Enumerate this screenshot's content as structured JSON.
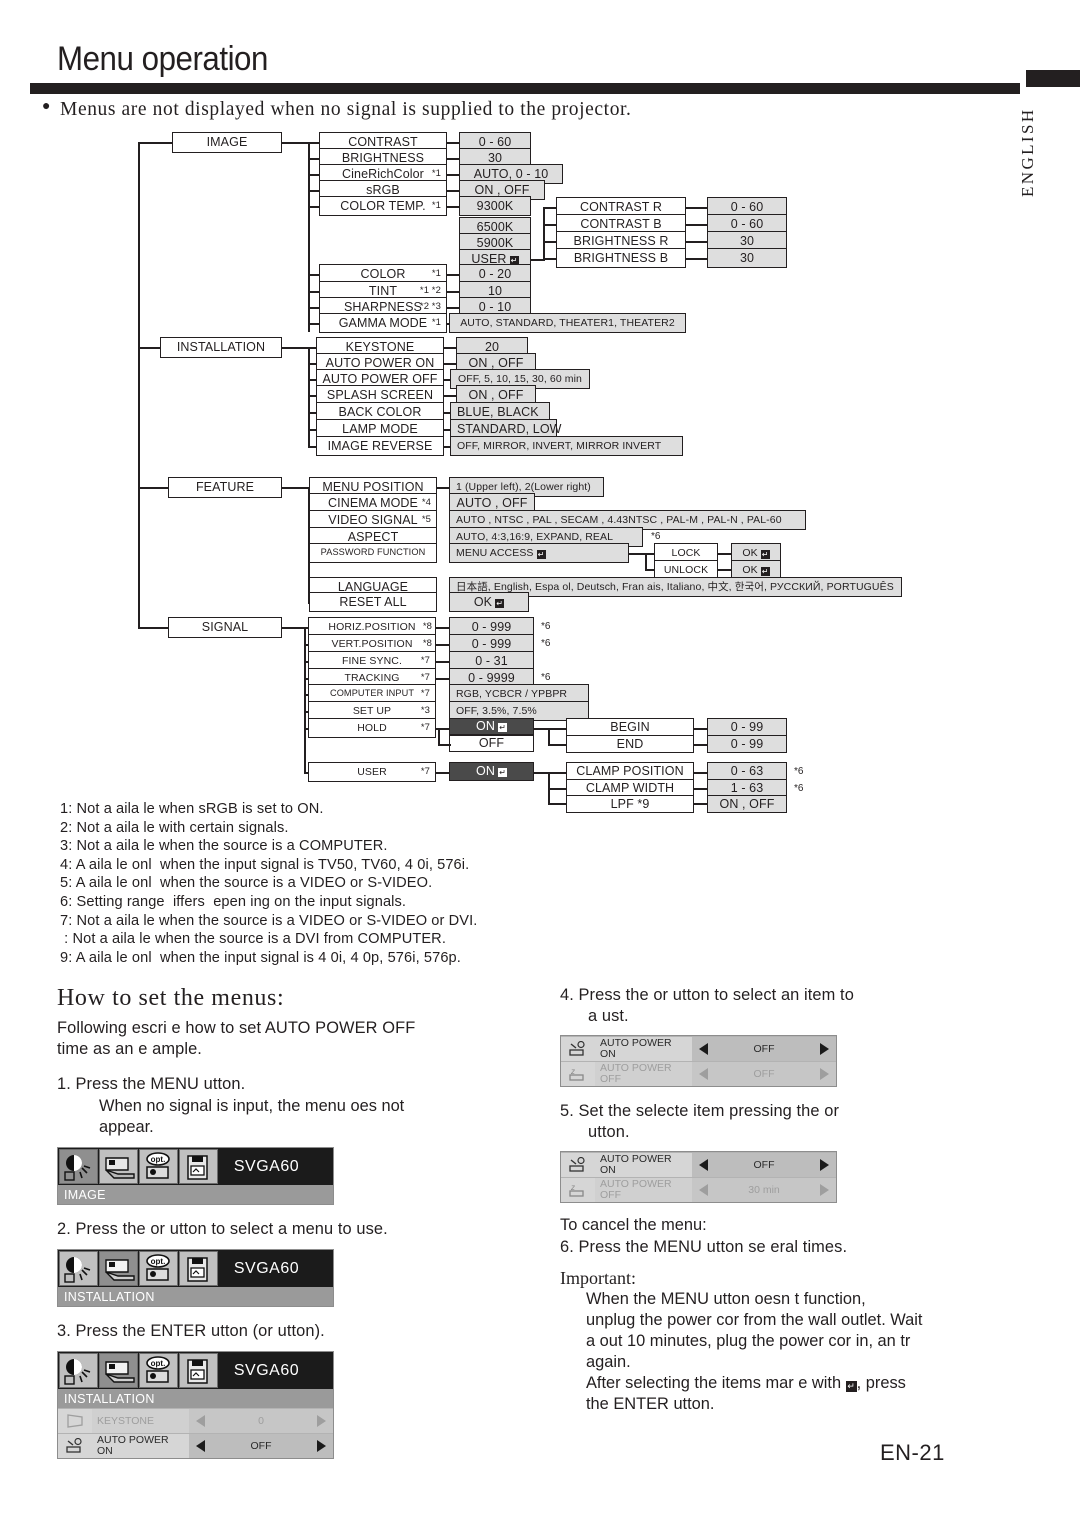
{
  "header": {
    "title": "Menu operation",
    "intro": "Menus are not displayed when no signal is supplied to the projector.",
    "language_tab": "ENGLISH",
    "page_number": "EN-21"
  },
  "tree": {
    "menus": [
      {
        "name": "IMAGE",
        "items": [
          {
            "label": "CONTRAST",
            "sup": "",
            "value": "0 - 60"
          },
          {
            "label": "BRIGHTNESS",
            "sup": "",
            "value": "30"
          },
          {
            "label": "CineRichColor",
            "sup": "*1",
            "value": "AUTO, 0 - 10"
          },
          {
            "label": "sRGB",
            "sup": "",
            "value": "ON , OFF"
          },
          {
            "label": "COLOR TEMP.",
            "sup": "*1",
            "value": "9300K"
          },
          {
            "label": "COLOR",
            "sup": "*1",
            "value": "0 - 20"
          },
          {
            "label": "TINT",
            "sup": "*1 *2",
            "value": "10"
          },
          {
            "label": "SHARPNESS",
            "sup": "*2 *3",
            "value": "0 - 10"
          },
          {
            "label": "GAMMA MODE",
            "sup": "*1",
            "value": "AUTO, STANDARD, THEATER1, THEATER2"
          }
        ]
      },
      {
        "name": "INSTALLATION",
        "items": [
          {
            "label": "KEYSTONE",
            "sup": "",
            "value": "20"
          },
          {
            "label": "AUTO POWER ON",
            "sup": "",
            "value": "ON , OFF"
          },
          {
            "label": "AUTO POWER OFF",
            "sup": "",
            "value": "OFF, 5, 10, 15, 30, 60 min"
          },
          {
            "label": "SPLASH SCREEN",
            "sup": "",
            "value": "ON , OFF"
          },
          {
            "label": "BACK COLOR",
            "sup": "",
            "value": "BLUE, BLACK"
          },
          {
            "label": "LAMP MODE",
            "sup": "",
            "value": "STANDARD, LOW"
          },
          {
            "label": "IMAGE REVERSE",
            "sup": "",
            "value": "OFF, MIRROR, INVERT, MIRROR INVERT"
          }
        ]
      },
      {
        "name": "FEATURE",
        "items": [
          {
            "label": "MENU POSITION",
            "sup": "",
            "value": "1 (Upper left), 2(Lower right)"
          },
          {
            "label": "CINEMA MODE",
            "sup": "*4",
            "value": "AUTO , OFF"
          },
          {
            "label": "VIDEO SIGNAL",
            "sup": "*5",
            "value": "AUTO , NTSC , PAL , SECAM , 4.43NTSC , PAL-M , PAL-N , PAL-60"
          },
          {
            "label": "ASPECT",
            "sup": "",
            "value": "AUTO, 4:3,16:9, EXPAND, REAL",
            "note": "*6"
          },
          {
            "label": "PASSWORD FUNCTION",
            "sup": "",
            "value": "MENU ACCESS"
          },
          {
            "label": "LANGUAGE",
            "sup": "",
            "value": "日本語, English, Espa ol, Deutsch, Fran ais, Italiano, 中文, 한국어, РУССКИЙ, PORTUGUÊS"
          },
          {
            "label": "RESET ALL",
            "sup": "",
            "value": "OK"
          }
        ]
      },
      {
        "name": "SIGNAL",
        "items": [
          {
            "label": "HORIZ.POSITION",
            "sup": "*8",
            "value": "0 - 999",
            "note": "*6"
          },
          {
            "label": "VERT.POSITION",
            "sup": "*8",
            "value": "0 - 999",
            "note": "*6"
          },
          {
            "label": "FINE SYNC.",
            "sup": "*7",
            "value": "0 - 31"
          },
          {
            "label": "TRACKING",
            "sup": "*7",
            "value": "0 - 9999",
            "note": "*6"
          },
          {
            "label": "COMPUTER INPUT",
            "sup": "*7",
            "value": "RGB, YCBCR / YPBPR"
          },
          {
            "label": "SET UP",
            "sup": "*3",
            "value": "OFF, 3.5%, 7.5%"
          },
          {
            "label": "HOLD",
            "sup": "*7",
            "value": "ON"
          },
          {
            "label": "USER",
            "sup": "*7",
            "value": "ON"
          }
        ]
      }
    ],
    "color_temp_options": [
      "9300K",
      "6500K",
      "5900K",
      "USER"
    ],
    "user_color_items": [
      {
        "label": "CONTRAST R",
        "value": "0 - 60"
      },
      {
        "label": "CONTRAST B",
        "value": "0 - 60"
      },
      {
        "label": "BRIGHTNESS R",
        "value": "30"
      },
      {
        "label": "BRIGHTNESS B",
        "value": "30"
      }
    ],
    "password_branch": [
      {
        "label": "LOCK",
        "value": "OK"
      },
      {
        "label": "UNLOCK",
        "value": "OK"
      }
    ],
    "hold_branch": {
      "on": "ON",
      "off": "OFF",
      "items": [
        {
          "label": "BEGIN",
          "value": "0 - 99"
        },
        {
          "label": "END",
          "value": "0 - 99"
        }
      ]
    },
    "user_branch": {
      "on": "ON",
      "items": [
        {
          "label": "CLAMP POSITION",
          "value": "0 - 63",
          "note": "*6"
        },
        {
          "label": "CLAMP WIDTH",
          "value": "1 - 63",
          "note": "*6"
        },
        {
          "label": "LPF *9",
          "value": "ON , OFF"
        }
      ]
    }
  },
  "footnotes": [
    "1: Not a aila le when sRGB is set to ON.",
    "2: Not a aila le with certain signals.",
    "3: Not a aila le when the source is a COMPUTER.",
    "4: A aila le onl  when the input signal is TV50, TV60, 4 0i, 576i.",
    "5: A aila le onl  when the source is a VIDEO or S-VIDEO.",
    "6: Setting range  iffers  epen ing on the input signals.",
    "7: Not a aila le when the source is a VIDEO or S-VIDEO or DVI.",
    " : Not a aila le when the source is a DVI from COMPUTER.",
    "9: A aila le onl  when the input signal is 4 0i, 4 0p, 576i, 576p."
  ],
  "how_to": {
    "heading": "How to set the menus:",
    "intro": "Following  escri e how to set AUTO POWER OFF\ntime as an e ample.",
    "step1": "1. Press the MENU  utton.",
    "step1_sub": "When no signal is input, the menu  oes not\nappear.",
    "step2": "2. Press the    or     utton to select a menu to use.",
    "step3": "3. Press the ENTER  utton (or     utton).",
    "step4": "4. Press the    or     utton to select an item to\n a ust.",
    "step5": "5. Set the selecte  item  pressing the    or\n  utton.",
    "cancel_title": "To cancel the menu:",
    "step6": "6. Press the MENU  utton se eral times.",
    "important_title": "Important:",
    "important_body": "When the MENU  utton  oesn t function,\nunplug the power cor  from the wall outlet. Wait\na out 10 minutes, plug the power cor  in, an  tr\nagain."
  },
  "osd": {
    "signal_label": "SVGA60",
    "icons": [
      "image-icon",
      "installation-icon",
      "feature-opt-icon",
      "signal-icon"
    ],
    "shot1": {
      "tab": "IMAGE",
      "selected_icon": 0,
      "rows": []
    },
    "shot2": {
      "tab": "INSTALLATION",
      "selected_icon": 1,
      "rows": []
    },
    "shot3": {
      "tab": "INSTALLATION",
      "selected_icon": 1,
      "rows": [
        {
          "icon": "keystone-icon",
          "label": "KEYSTONE",
          "value": "0",
          "dim": true
        },
        {
          "icon": "auto-power-on-icon",
          "label": "AUTO POWER\nON",
          "value": "OFF",
          "dim": false
        }
      ]
    },
    "shot4": {
      "rows": [
        {
          "icon": "auto-power-on-icon",
          "label": "AUTO POWER\nON",
          "value": "OFF",
          "dim": false
        },
        {
          "icon": "auto-power-off-icon",
          "label": "AUTO POWER\nOFF",
          "value": "OFF",
          "dim": true
        }
      ]
    },
    "shot5": {
      "rows": [
        {
          "icon": "auto-power-on-icon",
          "label": "AUTO POWER\nON",
          "value": "OFF",
          "dim": false
        },
        {
          "icon": "auto-power-off-icon",
          "label": "AUTO POWER\nOFF",
          "value": "30 min",
          "dim": true
        }
      ]
    }
  },
  "after_select": "After selecting the items mar e  with",
  "after_select2": ", press\nthe ENTER  utton."
}
